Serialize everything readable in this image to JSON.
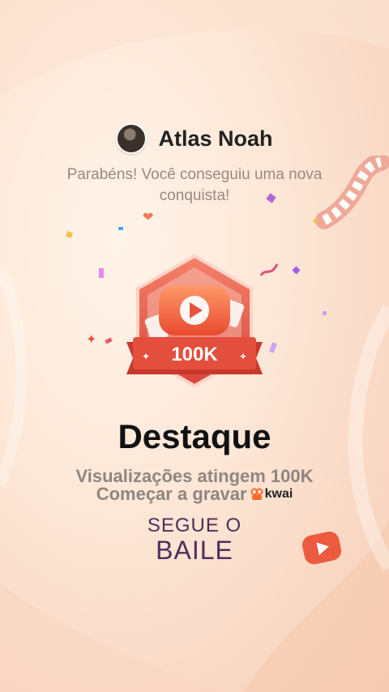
{
  "user": {
    "name": "Atlas Noah"
  },
  "message": "Parabéns! Você conseguiu uma nova conquista!",
  "badge": {
    "label": "100K",
    "icon": "play-icon"
  },
  "achievement": {
    "title": "Destaque",
    "description": "Visualizações atingem 100K",
    "cta": "Começar a gravar",
    "brand": "kwai"
  },
  "music": {
    "line1": "SEGUE O",
    "line2": "BAILE"
  },
  "colors": {
    "accent": "#e8533f",
    "badge_dark": "#c9382c",
    "background": "#fde8d8"
  }
}
